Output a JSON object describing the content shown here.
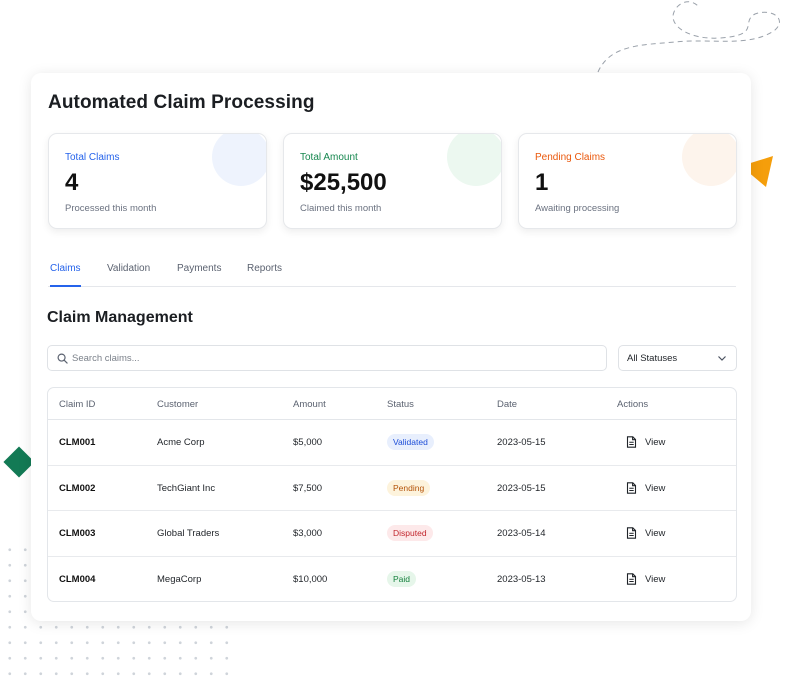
{
  "app": {
    "title": "Automated Claim Processing"
  },
  "stats": [
    {
      "label": "Total Claims",
      "value": "4",
      "sub": "Processed this month",
      "color": "#2563eb",
      "blob": "#eef3fd"
    },
    {
      "label": "Total Amount",
      "value": "$25,500",
      "sub": "Claimed this month",
      "color": "#16874f",
      "blob": "#ecf8f0"
    },
    {
      "label": "Pending Claims",
      "value": "1",
      "sub": "Awaiting processing",
      "color": "#ea580c",
      "blob": "#fdf4ec"
    }
  ],
  "tabs": [
    {
      "label": "Claims",
      "active": true
    },
    {
      "label": "Validation",
      "active": false
    },
    {
      "label": "Payments",
      "active": false
    },
    {
      "label": "Reports",
      "active": false
    }
  ],
  "section": {
    "title": "Claim Management"
  },
  "search": {
    "placeholder": "Search claims...",
    "icon": "search-icon"
  },
  "filter": {
    "selected": "All Statuses",
    "icon": "chevron-down-icon"
  },
  "table": {
    "headers": [
      "Claim ID",
      "Customer",
      "Amount",
      "Status",
      "Date",
      "Actions"
    ],
    "rows": [
      {
        "id": "CLM001",
        "customer": "Acme Corp",
        "amount": "$5,000",
        "status": "Validated",
        "date": "2023-05-15",
        "action": "View"
      },
      {
        "id": "CLM002",
        "customer": "TechGiant Inc",
        "amount": "$7,500",
        "status": "Pending",
        "date": "2023-05-15",
        "action": "View"
      },
      {
        "id": "CLM003",
        "customer": "Global Traders",
        "amount": "$3,000",
        "status": "Disputed",
        "date": "2023-05-14",
        "action": "View"
      },
      {
        "id": "CLM004",
        "customer": "MegaCorp",
        "amount": "$10,000",
        "status": "Paid",
        "date": "2023-05-13",
        "action": "View"
      }
    ],
    "status_colors": {
      "Validated": {
        "fg": "#1d4ed8",
        "bg": "#e8effd"
      },
      "Pending": {
        "fg": "#b45309",
        "bg": "#fdf3dc"
      },
      "Disputed": {
        "fg": "#c2262d",
        "bg": "#fde9ea"
      },
      "Paid": {
        "fg": "#15803d",
        "bg": "#e6f6ea"
      }
    },
    "action_icon": "document-icon"
  },
  "colors": {
    "accent": "#2563eb",
    "triangle": "#f59e0b",
    "diamond": "#137a55"
  }
}
